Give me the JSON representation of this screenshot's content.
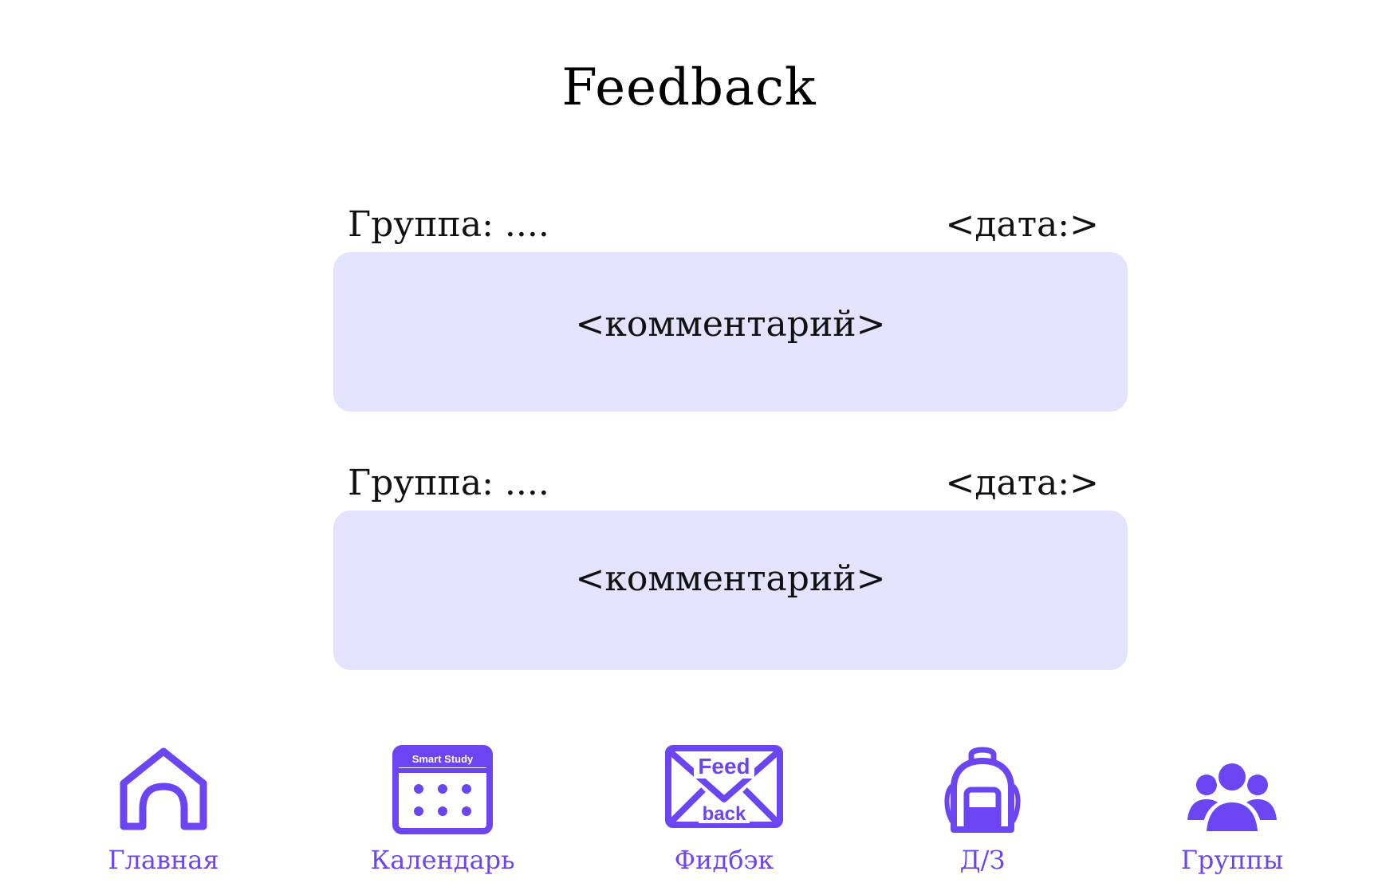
{
  "page": {
    "title": "Feedback"
  },
  "colors": {
    "accent": "#6c45f2",
    "card_background": "#e4e3fd",
    "text": "#111111",
    "background": "#ffffff"
  },
  "cards": [
    {
      "group_label": "Группа: ....",
      "date_label": "<дата:>",
      "comment": "<комментарий>"
    },
    {
      "group_label": "Группа: ....",
      "date_label": "<дата:>",
      "comment": "<комментарий>"
    }
  ],
  "nav": {
    "items": [
      {
        "label": "Главная",
        "icon": "home-icon"
      },
      {
        "label": "Календарь",
        "icon": "calendar-icon",
        "icon_text": "Smart Study"
      },
      {
        "label": "Фидбэк",
        "icon": "feedback-envelope-icon",
        "icon_text_top": "Feed",
        "icon_text_bottom": "back"
      },
      {
        "label": "Д/З",
        "icon": "backpack-icon"
      },
      {
        "label": "Группы",
        "icon": "groups-icon"
      }
    ]
  }
}
